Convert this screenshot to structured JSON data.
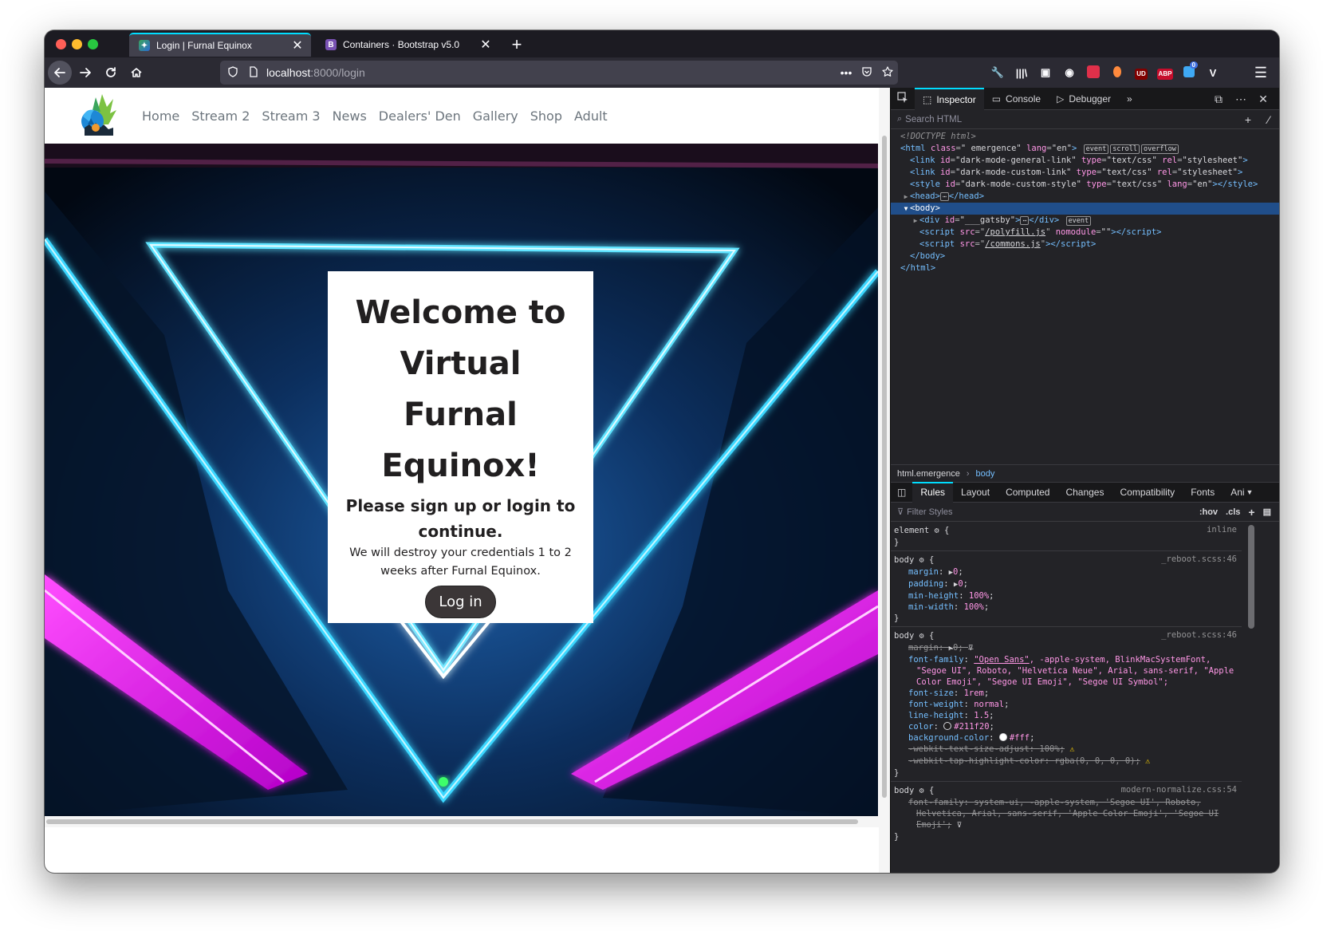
{
  "browser": {
    "tabs": [
      {
        "title": "Login | Furnal Equinox",
        "favicon": "furnal-equinox-logo",
        "close": "✕"
      },
      {
        "title": "Containers · Bootstrap v5.0",
        "favicon": "B",
        "close": "✕"
      }
    ],
    "new_tab": "+",
    "url_host": "localhost",
    "url_rest": ":8000/login",
    "url_actions": [
      "•••",
      "pocket-icon",
      "star-icon"
    ],
    "toolbar_badges": [
      "UD",
      "ABP"
    ],
    "notification_count": "0",
    "colors": {
      "accent": "#00ddff",
      "tab_bg": "#42414d",
      "chrome_bg": "#2b2a33"
    }
  },
  "site": {
    "nav": [
      "Home",
      "Stream 2",
      "Stream 3",
      "News",
      "Dealers' Den",
      "Gallery",
      "Shop",
      "Adult"
    ],
    "card": {
      "title": "Welcome to Virtual Furnal Equinox!",
      "subtitle": "Please sign up or login to continue.",
      "body": "We will destroy your credentials 1 to 2 weeks after Furnal Equinox.",
      "button": "Log in"
    },
    "colors": {
      "text": "#211f20",
      "button_bg": "#3b3637",
      "nav_link": "#6c757d"
    }
  },
  "devtools": {
    "tabs": [
      "Inspector",
      "Console",
      "Debugger"
    ],
    "more": "»",
    "search_placeholder": "Search HTML",
    "markup": {
      "doctype": "<!DOCTYPE html>",
      "html_class": "\" emergence\"",
      "html_lang": "\"en\"",
      "badges": [
        "event",
        "scroll",
        "overflow"
      ],
      "links": [
        {
          "tag": "link",
          "id": "\"dark-mode-general-link\"",
          "type": "\"text/css\"",
          "rel": "\"stylesheet\""
        },
        {
          "tag": "link",
          "id": "\"dark-mode-custom-link\"",
          "type": "\"text/css\"",
          "rel": "\"stylesheet\""
        }
      ],
      "style_id": "\"dark-mode-custom-style\"",
      "style_type": "\"text/css\"",
      "style_lang": "\"en\"",
      "div_id": "\"___gatsby\"",
      "div_badge": "event",
      "script1_src": "/polyfill.js",
      "script1_attr": "nomodule",
      "script1_attr_val": "\"\"",
      "script2_src": "/commons.js"
    },
    "breadcrumbs": [
      "html.emergence",
      "body"
    ],
    "subtabs": [
      "Rules",
      "Layout",
      "Computed",
      "Changes",
      "Compatibility",
      "Fonts",
      "Ani"
    ],
    "filter_placeholder": "Filter Styles",
    "filter_buttons": [
      ":hov",
      ".cls"
    ],
    "rules": {
      "element": {
        "selector": "element",
        "source": "inline"
      },
      "body1": {
        "selector": "body",
        "source": "_reboot.scss:46",
        "decls": [
          {
            "prop": "margin",
            "value": "0"
          },
          {
            "prop": "padding",
            "value": "0"
          },
          {
            "prop": "min-height",
            "value": "100%"
          },
          {
            "prop": "min-width",
            "value": "100%"
          }
        ]
      },
      "body2": {
        "selector": "body",
        "source": "_reboot.scss:46",
        "margin": {
          "prop": "margin",
          "value": "0"
        },
        "font_family_prop": "font-family",
        "font_family_link": "\"Open Sans\"",
        "font_family_rest1": ", -apple-system, BlinkMacSystemFont,",
        "font_family_rest2": "\"Segoe UI\", Roboto, \"Helvetica Neue\", Arial, sans-serif, \"Apple",
        "font_family_rest3": "Color Emoji\", \"Segoe UI Emoji\", \"Segoe UI Symbol\";",
        "font_size": {
          "prop": "font-size",
          "value": "1rem"
        },
        "font_weight": {
          "prop": "font-weight",
          "value": "normal"
        },
        "line_height": {
          "prop": "line-height",
          "value": "1.5"
        },
        "color": {
          "prop": "color",
          "value": "#211f20"
        },
        "bg": {
          "prop": "background-color",
          "value": "#fff"
        },
        "webkit1": {
          "prop": "-webkit-text-size-adjust",
          "value": "100%"
        },
        "webkit2": {
          "prop": "-webkit-tap-highlight-color",
          "value": "rgba(0, 0, 0, 0)"
        }
      },
      "body3": {
        "selector": "body",
        "source": "modern-normalize.css:54",
        "ff_prop": "font-family",
        "ff_val1": "system-ui, -apple-system, 'Segoe UI', Roboto,",
        "ff_val2": "Helvetica, Arial, sans-serif, 'Apple Color Emoji', 'Segoe UI",
        "ff_val3": "Emoji'"
      }
    }
  }
}
